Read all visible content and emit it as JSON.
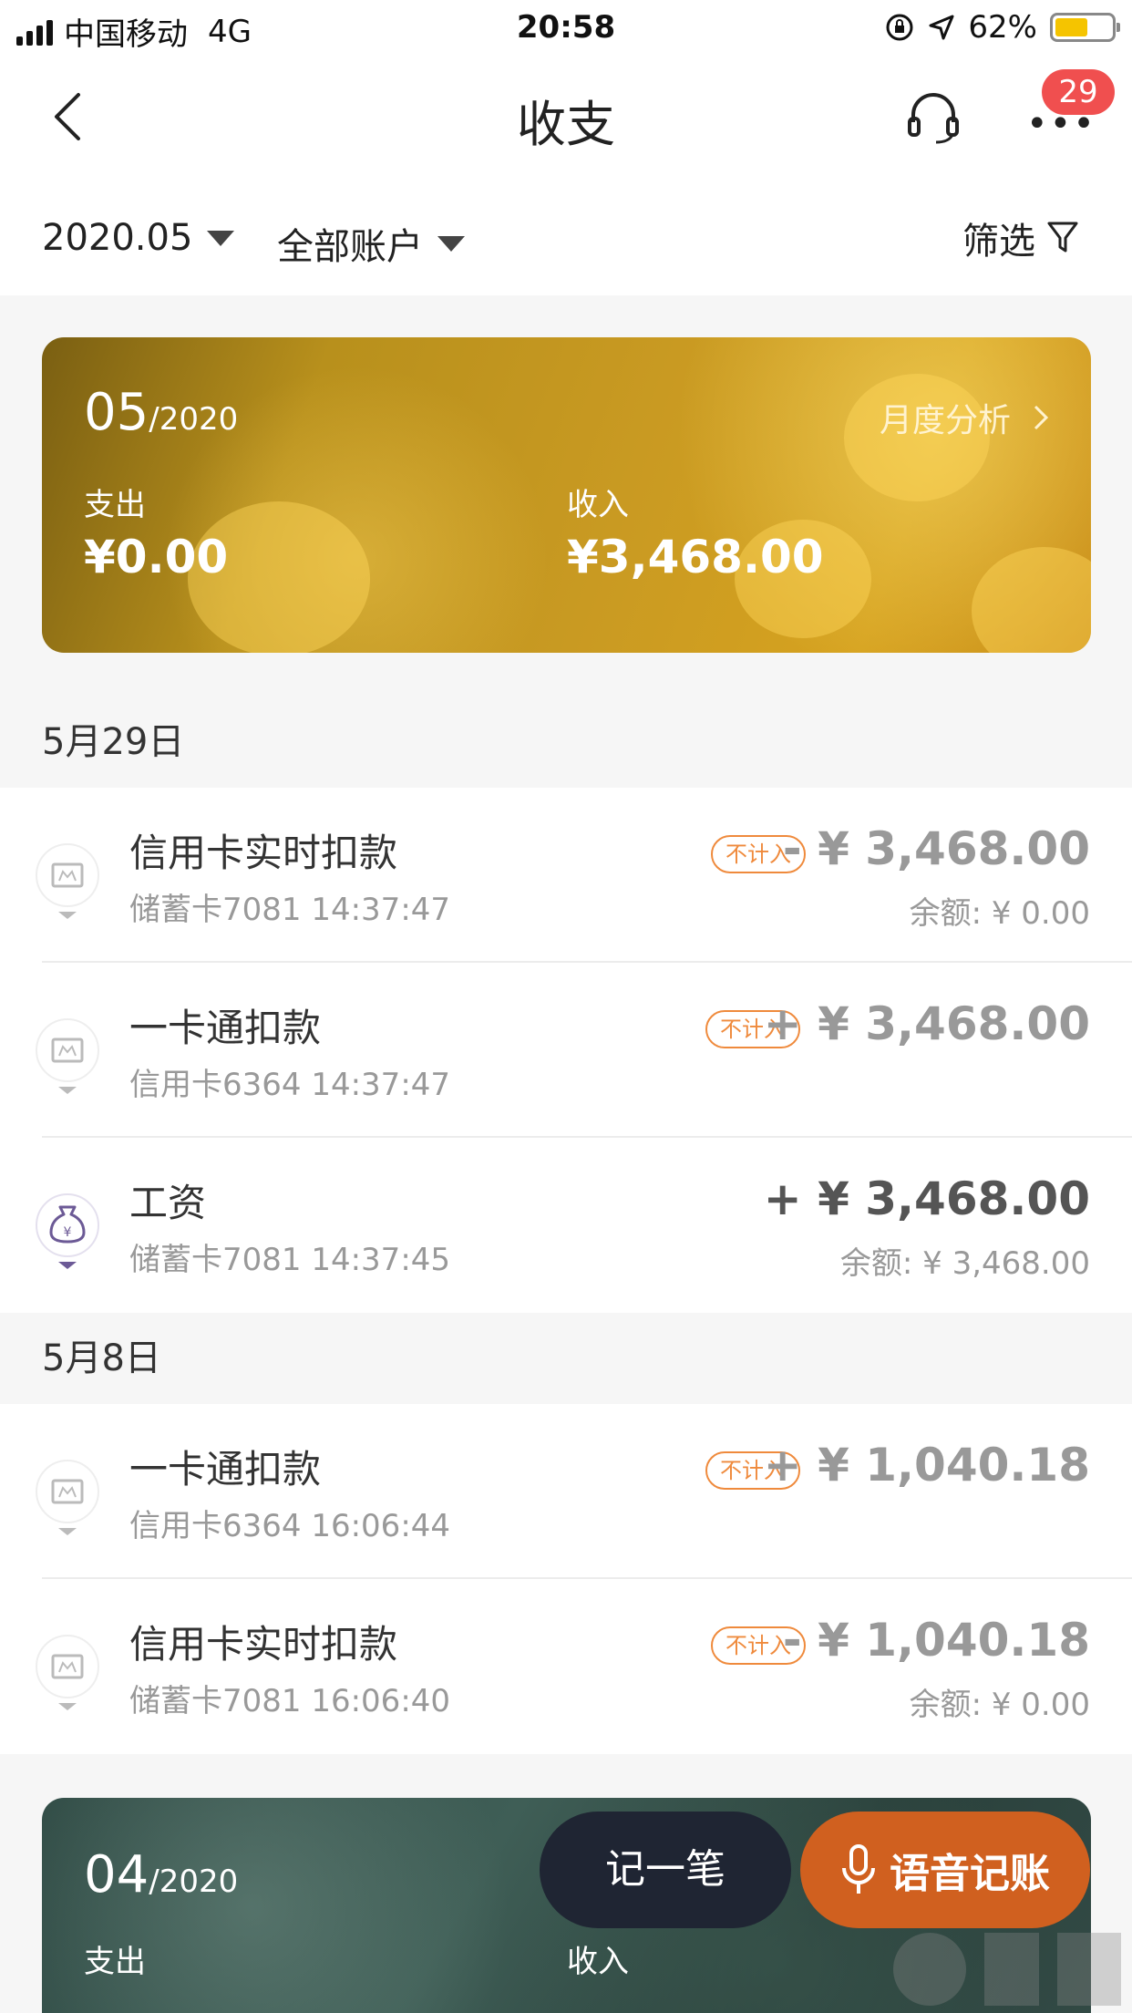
{
  "status_bar": {
    "carrier": "中国移动",
    "network": "4G",
    "time": "20:58",
    "battery_percent": "62%",
    "battery_level": 0.62
  },
  "nav": {
    "title": "收支",
    "badge_count": "29"
  },
  "filter": {
    "month": "2020.05",
    "account": "全部账户",
    "filter_label": "筛选"
  },
  "summary": {
    "month": "05",
    "year": "/2020",
    "analysis_label": "月度分析",
    "expense_label": "支出",
    "expense_amount": "¥0.00",
    "income_label": "收入",
    "income_amount": "¥3,468.00"
  },
  "sections": [
    {
      "date": "5月29日",
      "items": [
        {
          "title": "信用卡实时扣款",
          "sub": "储蓄卡7081 14:37:47",
          "tag": "不计入",
          "amount": "- ¥ 3,468.00",
          "balance": "余额: ¥ 0.00"
        },
        {
          "title": "一卡通扣款",
          "sub": "信用卡6364 14:37:47",
          "tag": "不计入",
          "amount": "+ ¥ 3,468.00",
          "balance": ""
        },
        {
          "title": "工资",
          "sub": "储蓄卡7081 14:37:45",
          "tag": "",
          "amount": "+ ¥ 3,468.00",
          "balance": "余额: ¥ 3,468.00"
        }
      ]
    },
    {
      "date": "5月8日",
      "items": [
        {
          "title": "一卡通扣款",
          "sub": "信用卡6364 16:06:44",
          "tag": "不计入",
          "amount": "+ ¥ 1,040.18",
          "balance": ""
        },
        {
          "title": "信用卡实时扣款",
          "sub": "储蓄卡7081 16:06:40",
          "tag": "不计入",
          "amount": "- ¥ 1,040.18",
          "balance": "余额: ¥ 0.00"
        }
      ]
    }
  ],
  "summary2": {
    "month": "04",
    "year": "/2020",
    "expense_label": "支出",
    "income_label": "收入"
  },
  "actions": {
    "record_label": "记一笔",
    "voice_label": "语音记账"
  },
  "icons": {
    "back": "back-arrow-icon",
    "headset": "headset-icon",
    "more": "more-icon",
    "filter": "funnel-icon",
    "card": "card-icon",
    "salary": "money-bag-icon",
    "mic": "mic-icon"
  },
  "colors": {
    "accent_orange": "#ef8a3c",
    "badge_red": "#f04f4f",
    "voice_button": "#d0601f",
    "record_button": "#1f2533"
  }
}
